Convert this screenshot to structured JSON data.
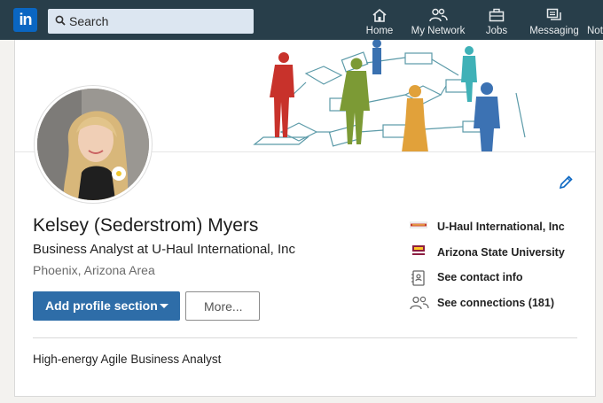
{
  "nav": {
    "search_placeholder": "Search",
    "items": [
      {
        "label": "Home",
        "icon": "home-icon"
      },
      {
        "label": "My Network",
        "icon": "network-icon"
      },
      {
        "label": "Jobs",
        "icon": "briefcase-icon"
      },
      {
        "label": "Messaging",
        "icon": "messaging-icon"
      },
      {
        "label": "Not",
        "icon": ""
      }
    ]
  },
  "profile": {
    "name": "Kelsey (Sederstrom) Myers",
    "headline": "Business Analyst at U-Haul International, Inc",
    "location": "Phoenix, Arizona Area",
    "summary": "High-energy Agile Business Analyst"
  },
  "actions": {
    "primary_label": "Add profile section",
    "secondary_label": "More..."
  },
  "sidebar": {
    "company": "U-Haul International, Inc",
    "school": "Arizona State University",
    "contact": "See contact info",
    "connections": "See connections (181)"
  },
  "colors": {
    "nav_bg": "#283e4a",
    "primary": "#2e6da8",
    "brand": "#0a66c2"
  }
}
